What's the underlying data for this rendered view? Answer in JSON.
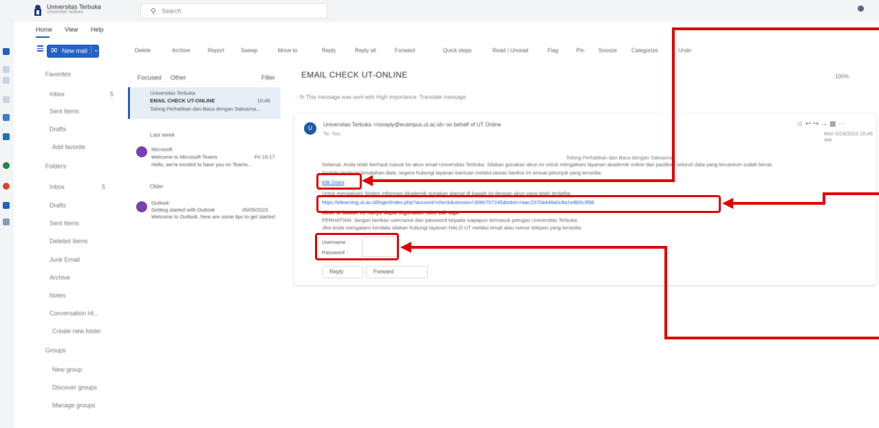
{
  "header": {
    "org_name": "Universitas Terbuka",
    "org_sub": "Universitas Terbuka",
    "search_placeholder": "Search"
  },
  "nav_tabs": [
    "Home",
    "View",
    "Help"
  ],
  "ribbon": {
    "new_mail": "New mail",
    "items": [
      "Delete",
      "Archive",
      "Report",
      "Sweep",
      "Move to",
      "Reply",
      "Reply all",
      "Forward",
      "Quick steps",
      "Read / Unread",
      "Flag",
      "Pin",
      "Snooze",
      "Categorize",
      "Undo"
    ]
  },
  "folders": {
    "favorites_label": "Favorites",
    "inbox_fav": "Inbox",
    "inbox_fav_count": "5",
    "sent_fav": "Sent Items",
    "drafts_fav": "Drafts",
    "add_favorite": "Add favorite",
    "folders_label": "Folders",
    "inbox": "Inbox",
    "inbox_count": "5",
    "drafts": "Drafts",
    "sent": "Sent Items",
    "deleted": "Deleted Items",
    "junk": "Junk Email",
    "archive": "Archive",
    "notes": "Notes",
    "conversation": "Conversation Hi...",
    "create_folder": "Create new folder",
    "groups_label": "Groups",
    "new_group": "New group",
    "discover_groups": "Discover groups",
    "manage_groups": "Manage groups"
  },
  "message_list": {
    "focused": "Focused",
    "other": "Other",
    "filter": "Filter",
    "group_last_week": "Last week",
    "group_older": "Older",
    "messages": [
      {
        "from": "Universitas Terbuka",
        "subject": "EMAIL CHECK UT-ONLINE",
        "time": "10:46",
        "preview": "Tolong Perhatikan dan Baca dengan Saksama..."
      },
      {
        "from": "Microsoft",
        "subject": "Welcome to Microsoft Teams",
        "time": "Fri 10:17",
        "preview": "Hello, we're excited to have you on Teams..."
      },
      {
        "from": "Outlook",
        "subject": "Getting started with Outlook",
        "time": "05/05/2023",
        "preview": "Welcome to Outlook, here are some tips to get started"
      }
    ]
  },
  "reading": {
    "subject": "EMAIL CHECK UT-ONLINE",
    "zoom": "100%",
    "info": "This message was sent with High importance. Translate message",
    "sender_initial": "U",
    "sender": "Universitas Terbuka <noreply@ecampus.ut.ac.id> on behalf of UT Online",
    "recipient": "To: You",
    "date": "Mon 5/29/2023 10:46 AM",
    "center_title": "Tolong Perhatikan dan Baca dengan Saksama",
    "body_line1": "Selamat, Anda telah berhasil masuk ke akun email Universitas Terbuka. Silakan gunakan akun ini untuk mengakses layanan akademik online dan pastikan seluruh data yang tercantum sudah benar.",
    "body_line2": "Apabila terdapat kesalahan data, segera hubungi layanan bantuan melalui tautan berikut ini sesuai petunjuk yang tersedia.",
    "link_label": "Klik Disini",
    "body_line3": "Untuk mengakses Sistem Informasi Akademik gunakan alamat di bawah ini dengan akun yang telah terdaftar.",
    "url": "https://elearning.ut.ac.id/login/index.php?account=check&session=3060707245&token=aac2370a4d4a0c8a1e8b5c3f98",
    "body_line4": "Akun di bawah ini hanya dapat digunakan satu kali saja:",
    "body_line5": "PERHATIAN: Jangan berikan username dan password kepada siapapun termasuk petugas Universitas Terbuka.",
    "body_line6": "Jika Anda mengalami kendala silakan hubungi layanan HALO UT melalui email atau nomor telepon yang tersedia.",
    "username_label": "Username :",
    "password_label": "Password :",
    "reply": "Reply",
    "forward": "Forward"
  }
}
